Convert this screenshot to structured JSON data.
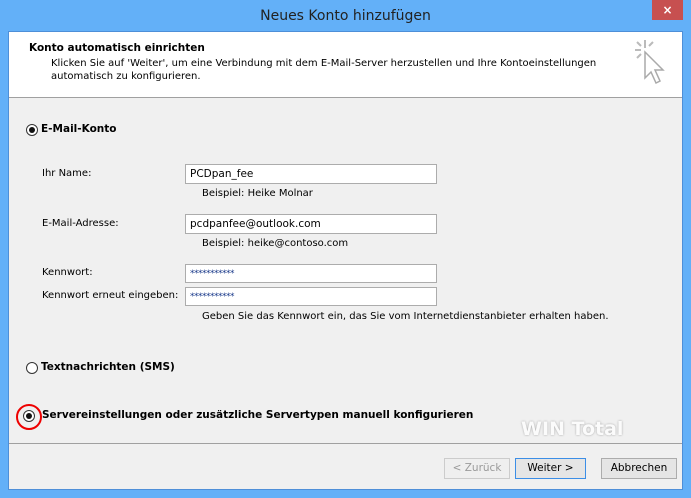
{
  "window": {
    "title": "Neues Konto hinzufügen",
    "close_icon": "×"
  },
  "header": {
    "title": "Konto automatisch einrichten",
    "description": "Klicken Sie auf 'Weiter', um eine Verbindung mit dem E-Mail-Server herzustellen und Ihre Kontoeinstellungen automatisch zu konfigurieren."
  },
  "options": {
    "email": "E-Mail-Konto",
    "sms": "Textnachrichten (SMS)",
    "manual": "Servereinstellungen oder zusätzliche Servertypen manuell konfigurieren"
  },
  "form": {
    "name_label": "Ihr Name:",
    "name_value": "PCDpan_fee",
    "name_hint": "Beispiel: Heike Molnar",
    "email_label": "E-Mail-Adresse:",
    "email_value": "pcdpanfee@outlook.com",
    "email_hint": "Beispiel: heike@contoso.com",
    "password_label": "Kennwort:",
    "password_value": "***********",
    "password2_label": "Kennwort erneut eingeben:",
    "password2_value": "***********",
    "password_hint": "Geben Sie das Kennwort ein, das Sie vom Internetdienstanbieter erhalten haben."
  },
  "buttons": {
    "back": "< Zurück",
    "next": "Weiter >",
    "cancel": "Abbrechen"
  },
  "watermark": "WIN Total"
}
